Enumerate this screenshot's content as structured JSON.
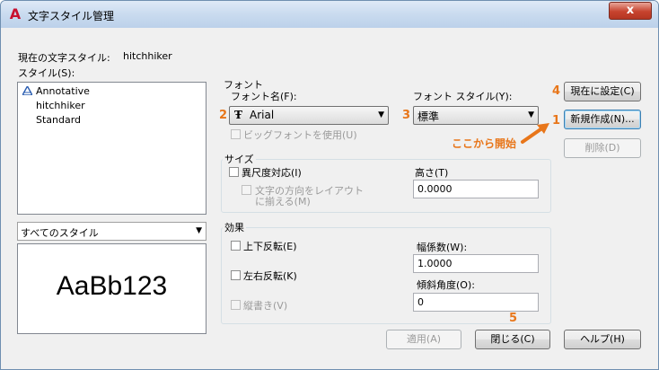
{
  "window": {
    "title": "文字スタイル管理",
    "close_label": "x",
    "app_icon_glyph": "A"
  },
  "current_style": {
    "label": "現在の文字スタイル:",
    "value": "hitchhiker"
  },
  "styles": {
    "label": "スタイル(S):",
    "items": [
      {
        "name": "Annotative",
        "icon": "annotative-scale-icon"
      },
      {
        "name": "hitchhiker"
      },
      {
        "name": "Standard"
      }
    ],
    "filter_selected": "すべてのスタイル"
  },
  "preview": {
    "sample_text": "AaBb123"
  },
  "font": {
    "group_title": "フォント",
    "name_label": "フォント名(F):",
    "name_value": "Arial",
    "truetype_icon_glyph": "Ŧ",
    "style_label": "フォント スタイル(Y):",
    "style_value": "標準",
    "bigfont_label": "ビッグフォントを使用(U)"
  },
  "size": {
    "group_title": "サイズ",
    "annotative_label": "異尺度対応(I)",
    "orientation_label_line1": "文字の方向をレイアウト",
    "orientation_label_line2": "に揃える(M)",
    "height_label": "高さ(T)",
    "height_value": "0.0000"
  },
  "effects": {
    "group_title": "効果",
    "upside_down_label": "上下反転(E)",
    "backwards_label": "左右反転(K)",
    "vertical_label": "縦書き(V)",
    "width_factor_label": "幅係数(W):",
    "width_factor_value": "1.0000",
    "oblique_label": "傾斜角度(O):",
    "oblique_value": "0"
  },
  "buttons": {
    "set_current": "現在に設定(C)",
    "new": "新規作成(N)...",
    "delete": "削除(D)",
    "apply": "適用(A)",
    "close": "閉じる(C)",
    "help": "ヘルプ(H)"
  },
  "annotations": {
    "marker_1": "1",
    "marker_2": "2",
    "marker_3": "3",
    "marker_4": "4",
    "marker_5": "5",
    "start_here": "ここから開始",
    "color": "#e8761a"
  }
}
